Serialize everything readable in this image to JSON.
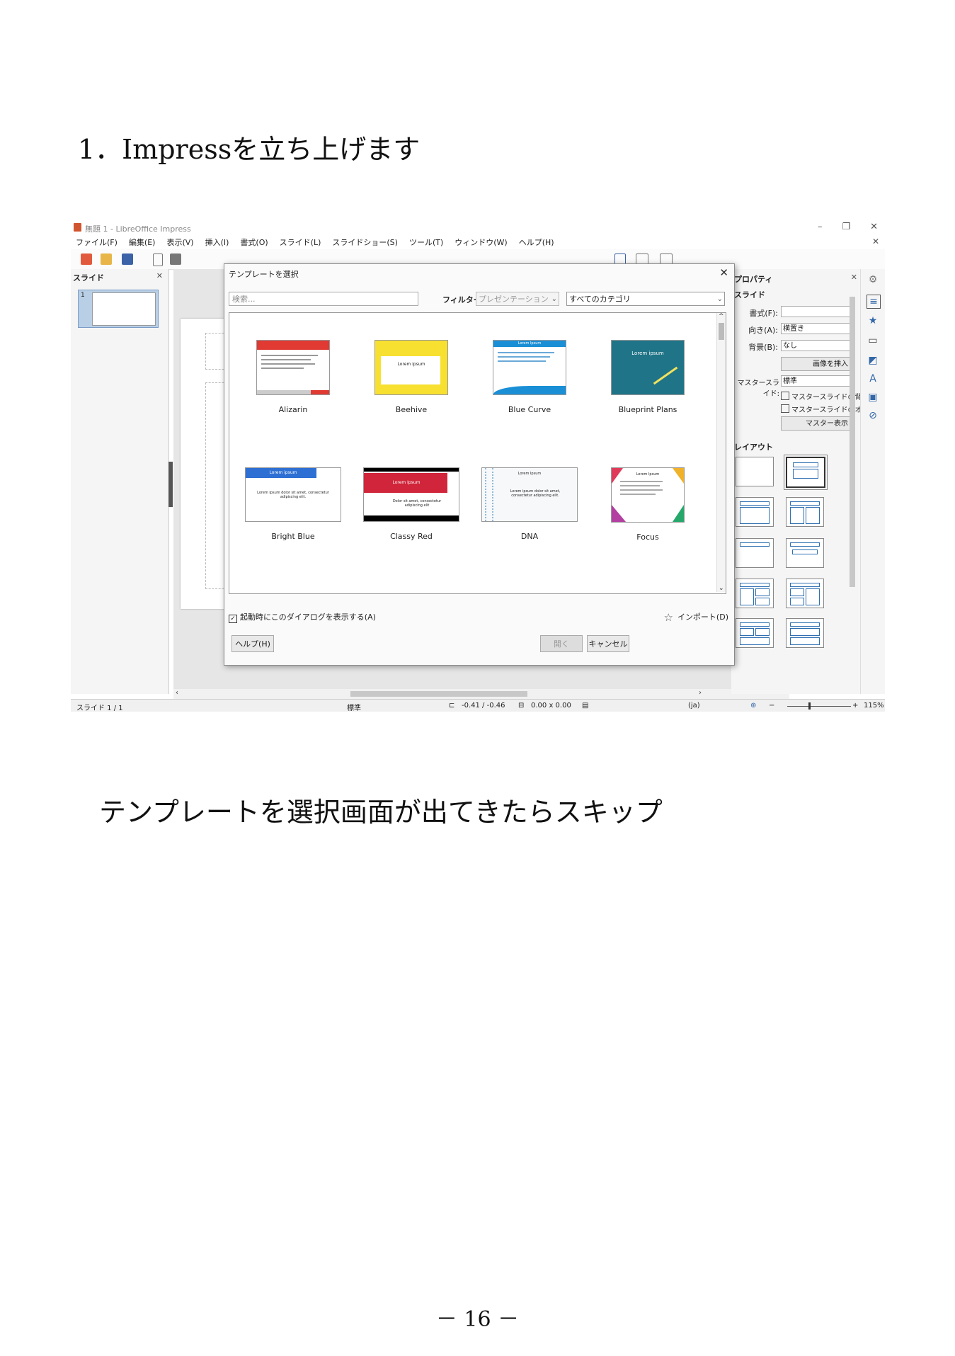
{
  "heading": "1．Impressを立ち上げます",
  "caption": "テンプレートを選択画面が出てきたらスキップ",
  "page_number": "－ 16 －",
  "window": {
    "title": "無題 1 - LibreOffice Impress",
    "menu": [
      "ファイル(F)",
      "編集(E)",
      "表示(V)",
      "挿入(I)",
      "書式(O)",
      "スライド(L)",
      "スライドショー(S)",
      "ツール(T)",
      "ウィンドウ(W)",
      "ヘルプ(H)"
    ]
  },
  "slide_pane": {
    "title": "スライド",
    "slide_number": "1"
  },
  "dialog": {
    "title": "テンプレートを選択",
    "search_placeholder": "検索...",
    "filter_label": "フィルター",
    "filter_value": "プレゼンテーション",
    "category_value": "すべてのカテゴリ",
    "templates": [
      {
        "name": "Alizarin",
        "accent": "#e03a33"
      },
      {
        "name": "Beehive",
        "accent": "#f7e030"
      },
      {
        "name": "Blue Curve",
        "accent": "#1a8fd6"
      },
      {
        "name": "Blueprint Plans",
        "accent": "#1f7487"
      },
      {
        "name": "Bright Blue",
        "accent": "#2d6fd3"
      },
      {
        "name": "Classy Red",
        "accent": "#d0253a"
      },
      {
        "name": "DNA",
        "accent": "#8fb8d8"
      },
      {
        "name": "Focus",
        "accent": "#b23fa1"
      }
    ],
    "preview_texts": {
      "lorem": "Lorem Ipsum",
      "lorem_lower": "Lorem ipsum",
      "dolor": "Lorem ipsum dolor sit amet, consectetur adipiscing elit.",
      "dolor_short": "Dolor sit amet, consectetur adipiscing elit"
    },
    "show_on_startup": "起動時にこのダイアログを表示する(A)",
    "import_label": "インポート(D)",
    "help_button": "ヘルプ(H)",
    "open_button": "開く",
    "cancel_button": "キャンセル"
  },
  "sidebar": {
    "title": "プロパティ",
    "slide_section": "スライド",
    "format_label": "書式(F):",
    "orientation_label": "向き(A):",
    "orientation_value": "横置き",
    "background_label": "背景(B):",
    "background_value": "なし",
    "insert_image_button": "画像を挿入",
    "master_slide_label": "マスタースライド:",
    "master_slide_value": "標準",
    "master_check1": "マスタースライドの背景",
    "master_check2": "マスタースライドのオブジェクト",
    "master_button": "マスター表示",
    "layout_section": "レイアウト"
  },
  "status": {
    "slide": "スライド 1 / 1",
    "master": "標準",
    "position": "-0.41 / -0.46",
    "size": "0.00 x 0.00",
    "lang": "(ja)",
    "zoom": "115%"
  }
}
